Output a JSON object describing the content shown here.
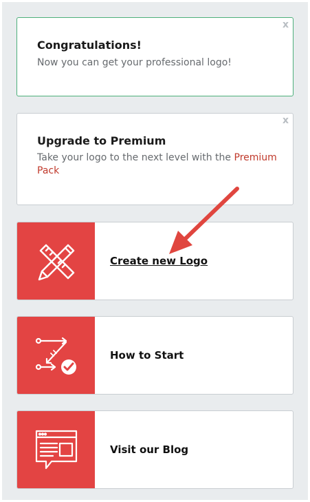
{
  "congrats": {
    "close": "x",
    "title": "Congratulations!",
    "text": "Now you can get your professional logo!"
  },
  "upgrade": {
    "close": "x",
    "title": "Upgrade to Premium",
    "text": "Take your logo to the next level with the ",
    "link": "Premium Pack"
  },
  "actions": [
    {
      "label": "Create new Logo",
      "icon": "pencil-ruler-icon"
    },
    {
      "label": "How to Start",
      "icon": "steps-checkmark-icon"
    },
    {
      "label": "Visit our Blog",
      "icon": "blog-browser-icon"
    }
  ],
  "colors": {
    "accent": "#e34443",
    "link": "#c0392b",
    "success_border": "#4caf7a",
    "annotation_arrow": "#e0463f"
  }
}
